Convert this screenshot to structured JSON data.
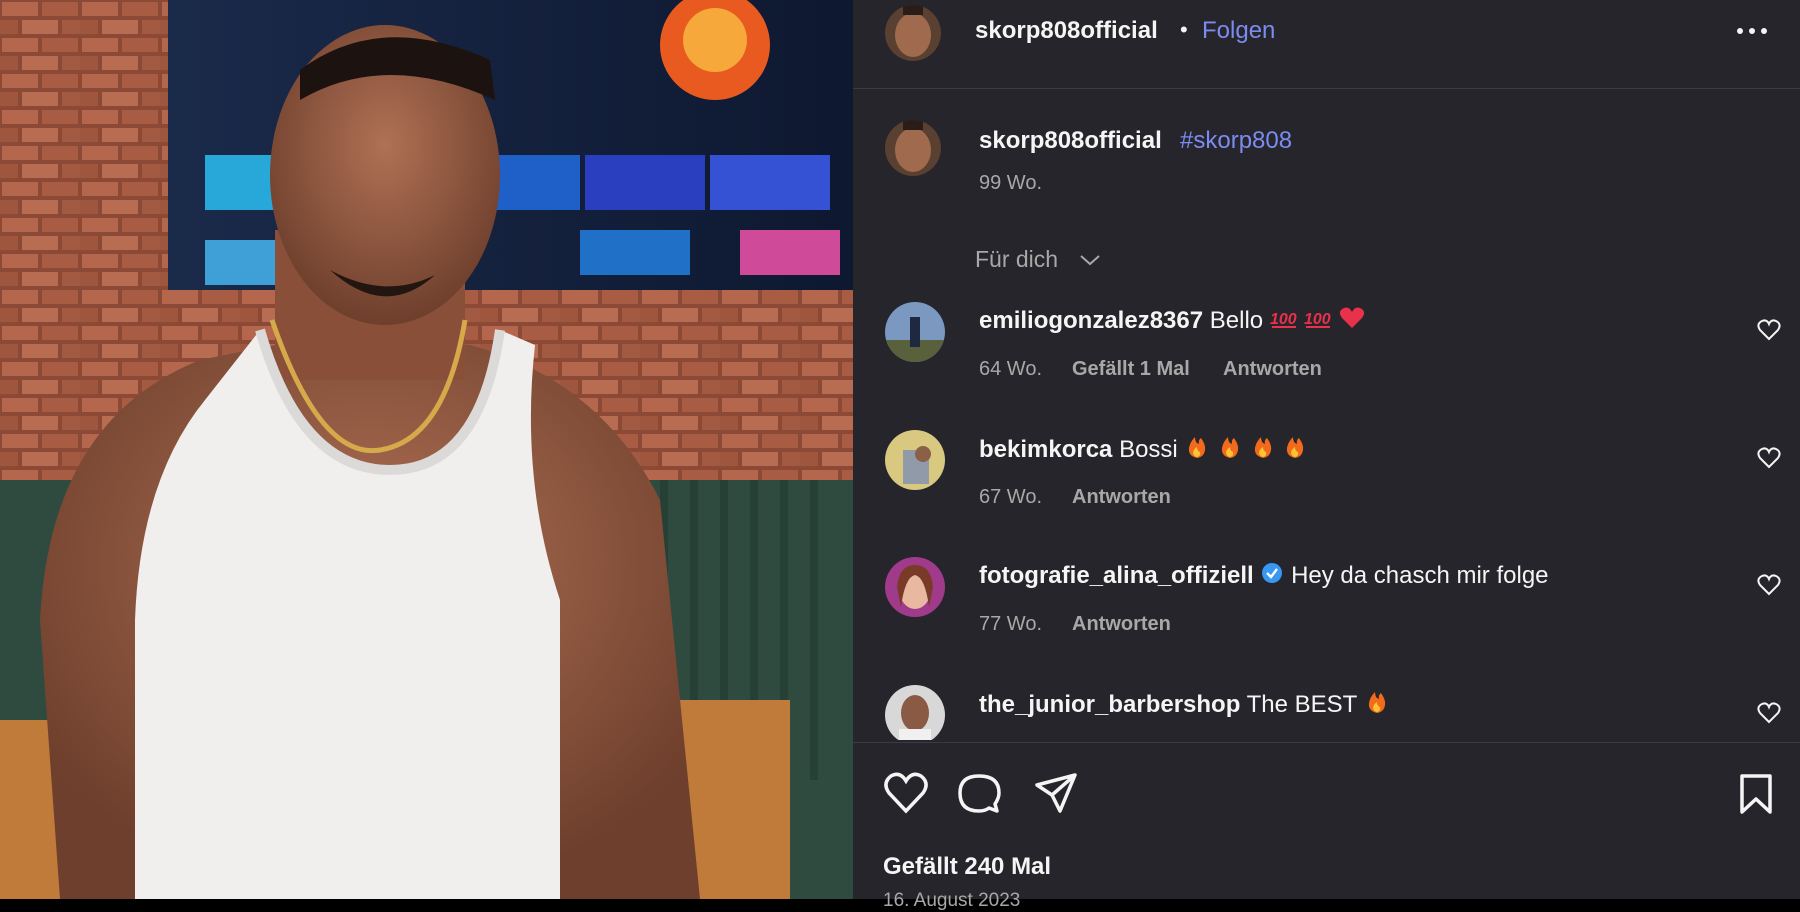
{
  "header": {
    "username": "skorp808official",
    "separator": "•",
    "follow_label": "Folgen",
    "more_icon": "more-horizontal-icon"
  },
  "caption": {
    "username": "skorp808official",
    "hashtag": "#skorp808",
    "age": "99 Wo."
  },
  "filter": {
    "label": "Für dich",
    "icon": "chevron-down-icon"
  },
  "comments": [
    {
      "username": "emiliogonzalez8367",
      "text": "Bello",
      "emoji": [
        "hundred-points-icon",
        "hundred-points-icon",
        "red-heart-icon"
      ],
      "age": "64 Wo.",
      "likes": "Gefällt 1 Mal",
      "reply": "Antworten",
      "verified": false
    },
    {
      "username": "bekimkorca",
      "text": "Bossi",
      "emoji": [
        "fire-icon",
        "fire-icon",
        "fire-icon",
        "fire-icon"
      ],
      "age": "67 Wo.",
      "likes": "",
      "reply": "Antworten",
      "verified": false
    },
    {
      "username": "fotografie_alina_offiziell",
      "text": "Hey da chasch mir folge",
      "emoji": [],
      "age": "77 Wo.",
      "likes": "",
      "reply": "Antworten",
      "verified": true
    },
    {
      "username": "the_junior_barbershop",
      "text": "The BEST",
      "emoji": [
        "fire-icon"
      ],
      "age": "",
      "likes": "",
      "reply": "",
      "verified": false
    }
  ],
  "actions": {
    "like_icon": "heart-icon",
    "comment_icon": "comment-icon",
    "share_icon": "send-icon",
    "save_icon": "bookmark-icon"
  },
  "likes_count": "Gefällt 240 Mal",
  "post_date": "16. August 2023",
  "colors": {
    "panel_bg": "#25252b",
    "link": "#7b8cf0",
    "text": "#f5f5f5",
    "muted": "#a8a8a8",
    "verified": "#3897f0"
  }
}
